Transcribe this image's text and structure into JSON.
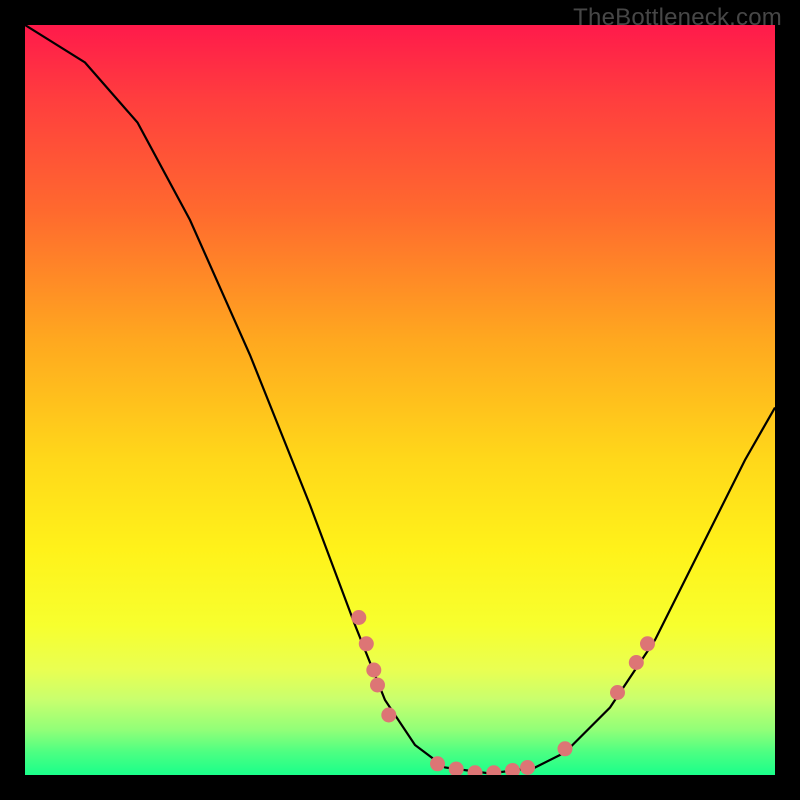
{
  "watermark": "TheBottleneck.com",
  "chart_data": {
    "type": "line",
    "title": "",
    "xlabel": "",
    "ylabel": "",
    "xlim": [
      0,
      100
    ],
    "ylim": [
      0,
      100
    ],
    "grid": false,
    "legend": false,
    "curve": [
      {
        "x": 0.0,
        "y": 100.0
      },
      {
        "x": 8.0,
        "y": 95.0
      },
      {
        "x": 15.0,
        "y": 87.0
      },
      {
        "x": 22.0,
        "y": 74.0
      },
      {
        "x": 30.0,
        "y": 56.0
      },
      {
        "x": 38.0,
        "y": 36.0
      },
      {
        "x": 44.0,
        "y": 20.0
      },
      {
        "x": 48.0,
        "y": 10.0
      },
      {
        "x": 52.0,
        "y": 4.0
      },
      {
        "x": 56.0,
        "y": 1.0
      },
      {
        "x": 62.0,
        "y": 0.2
      },
      {
        "x": 68.0,
        "y": 1.0
      },
      {
        "x": 72.0,
        "y": 3.0
      },
      {
        "x": 78.0,
        "y": 9.0
      },
      {
        "x": 84.0,
        "y": 18.0
      },
      {
        "x": 90.0,
        "y": 30.0
      },
      {
        "x": 96.0,
        "y": 42.0
      },
      {
        "x": 100.0,
        "y": 49.0
      }
    ],
    "markers": [
      {
        "x": 44.5,
        "y": 21.0
      },
      {
        "x": 45.5,
        "y": 17.5
      },
      {
        "x": 46.5,
        "y": 14.0
      },
      {
        "x": 47.0,
        "y": 12.0
      },
      {
        "x": 48.5,
        "y": 8.0
      },
      {
        "x": 55.0,
        "y": 1.5
      },
      {
        "x": 57.5,
        "y": 0.8
      },
      {
        "x": 60.0,
        "y": 0.3
      },
      {
        "x": 62.5,
        "y": 0.3
      },
      {
        "x": 65.0,
        "y": 0.6
      },
      {
        "x": 67.0,
        "y": 1.0
      },
      {
        "x": 72.0,
        "y": 3.5
      },
      {
        "x": 79.0,
        "y": 11.0
      },
      {
        "x": 81.5,
        "y": 15.0
      },
      {
        "x": 83.0,
        "y": 17.5
      }
    ]
  }
}
